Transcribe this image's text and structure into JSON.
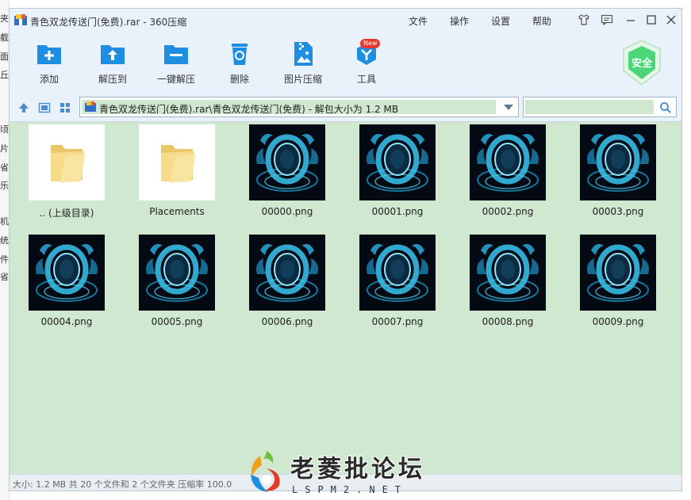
{
  "background_strip": [
    "夹",
    "截",
    "面",
    "丘",
    "顷",
    "片",
    "省",
    "乐",
    "机",
    "统",
    "件",
    "省"
  ],
  "window": {
    "title": "青色双龙传送门(免费).rar - 360压缩",
    "menu": [
      "文件",
      "操作",
      "设置",
      "帮助"
    ]
  },
  "toolbar": {
    "items": [
      {
        "label": "添加",
        "icon": "add-folder-icon"
      },
      {
        "label": "解压到",
        "icon": "extract-to-icon"
      },
      {
        "label": "一键解压",
        "icon": "one-click-extract-icon"
      },
      {
        "label": "删除",
        "icon": "recycle-bin-icon"
      },
      {
        "label": "图片压缩",
        "icon": "image-compress-icon"
      },
      {
        "label": "工具",
        "icon": "tools-icon",
        "badge": "New"
      }
    ],
    "shield_label": "安全"
  },
  "address": {
    "path": "青色双龙传送门(免费).rar\\青色双龙传送门(免费) - 解包大小为 1.2 MB",
    "search_value": ""
  },
  "files": [
    {
      "name": ".. (上级目录)",
      "type": "folder"
    },
    {
      "name": "Placements",
      "type": "folder"
    },
    {
      "name": "00000.png",
      "type": "png"
    },
    {
      "name": "00001.png",
      "type": "png"
    },
    {
      "name": "00002.png",
      "type": "png"
    },
    {
      "name": "00003.png",
      "type": "png"
    },
    {
      "name": "00004.png",
      "type": "png"
    },
    {
      "name": "00005.png",
      "type": "png"
    },
    {
      "name": "00006.png",
      "type": "png"
    },
    {
      "name": "00007.png",
      "type": "png"
    },
    {
      "name": "00008.png",
      "type": "png"
    },
    {
      "name": "00009.png",
      "type": "png"
    }
  ],
  "status": "大小: 1.2 MB 共 20 个文件和 2 个文件夹 压缩率 100.0",
  "watermark": {
    "main": "老菱批论坛",
    "sub": "LSPM2.NET"
  },
  "colors": {
    "accent": "#1e8fe0",
    "content_bg": "#cfe8cf",
    "toolbar_bg": "#e9f2fb",
    "badge": "#e8382f",
    "shield": "#4cd67a"
  }
}
